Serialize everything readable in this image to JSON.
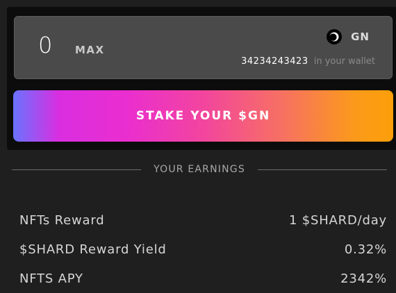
{
  "input_card": {
    "amount": "0",
    "max_label": "MAX",
    "token_symbol": "GN",
    "token_icon": "gn-token-icon",
    "wallet_balance": "34234243423",
    "wallet_suffix": "in your wallet"
  },
  "stake_button": {
    "label": "STAKE YOUR $GN"
  },
  "earnings": {
    "title": "YOUR EARNINGS",
    "rows": [
      {
        "label": "NFTs Reward",
        "value": "1 $SHARD/day"
      },
      {
        "label": "$SHARD Reward Yield",
        "value": "0.32%"
      },
      {
        "label": "NFTS APY",
        "value": "2342%"
      }
    ]
  },
  "colors": {
    "background": "#1f1f1f",
    "panel": "#0c0c0c",
    "input_card": "#4a4a4a",
    "gradient_start": "#6a73ff",
    "gradient_pink": "#ea2ecf",
    "gradient_end": "#fc9f0a"
  }
}
